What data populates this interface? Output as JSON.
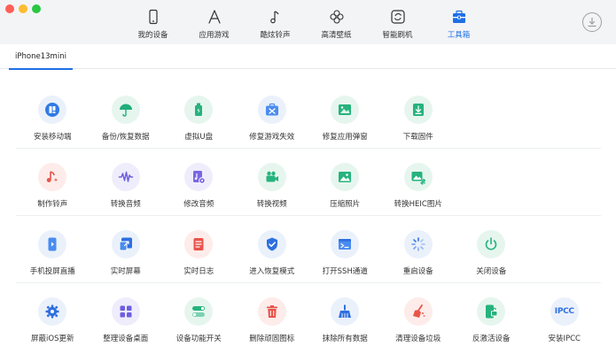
{
  "nav": {
    "items": [
      {
        "label": "我的设备",
        "icon": "phone-icon"
      },
      {
        "label": "应用游戏",
        "icon": "app-store-icon"
      },
      {
        "label": "酷炫铃声",
        "icon": "music-note-icon"
      },
      {
        "label": "高清壁纸",
        "icon": "flower-icon"
      },
      {
        "label": "智能刷机",
        "icon": "refresh-icon"
      },
      {
        "label": "工具箱",
        "icon": "toolbox-icon"
      }
    ],
    "active_index": 5
  },
  "device_tab": {
    "label": "iPhone13mini"
  },
  "colors": {
    "accent": "#1e6fe6",
    "icon_bg": "#eef1f6"
  },
  "tools": [
    [
      {
        "label": "安装移动端",
        "icon": "mobile-app-icon"
      },
      {
        "label": "备份/恢复数据",
        "icon": "umbrella-icon"
      },
      {
        "label": "虚拟U盘",
        "icon": "usb-drive-icon"
      },
      {
        "label": "修复游戏失效",
        "icon": "repair-toolbox-icon"
      },
      {
        "label": "修复应用弹窗",
        "icon": "image-repair-icon"
      },
      {
        "label": "下载固件",
        "icon": "download-firmware-icon"
      }
    ],
    [
      {
        "label": "制作铃声",
        "icon": "ringtone-icon"
      },
      {
        "label": "转换音频",
        "icon": "audio-wave-icon"
      },
      {
        "label": "修改音频",
        "icon": "audio-file-edit-icon"
      },
      {
        "label": "转换视频",
        "icon": "video-camera-icon"
      },
      {
        "label": "压缩照片",
        "icon": "photo-icon"
      },
      {
        "label": "转换HEIC图片",
        "icon": "heic-convert-icon"
      }
    ],
    [
      {
        "label": "手机投屏直播",
        "icon": "screen-cast-icon"
      },
      {
        "label": "实时屏幕",
        "icon": "realtime-screen-icon"
      },
      {
        "label": "实时日志",
        "icon": "log-icon"
      },
      {
        "label": "进入恢复模式",
        "icon": "shield-check-icon"
      },
      {
        "label": "打开SSH通道",
        "icon": "terminal-icon"
      },
      {
        "label": "重启设备",
        "icon": "restart-spinner-icon"
      },
      {
        "label": "关闭设备",
        "icon": "power-icon"
      }
    ],
    [
      {
        "label": "屏蔽iOS更新",
        "icon": "gear-icon"
      },
      {
        "label": "整理设备桌面",
        "icon": "grid-apps-icon"
      },
      {
        "label": "设备功能开关",
        "icon": "toggle-switch-icon"
      },
      {
        "label": "删除顽固图标",
        "icon": "trash-icon"
      },
      {
        "label": "抹除所有数据",
        "icon": "broom-icon"
      },
      {
        "label": "清理设备垃圾",
        "icon": "cleanup-icon"
      },
      {
        "label": "反激活设备",
        "icon": "phone-unlock-icon"
      },
      {
        "label": "安装IPCC",
        "icon": "ipcc-icon",
        "glyph": "IPCC"
      }
    ]
  ]
}
